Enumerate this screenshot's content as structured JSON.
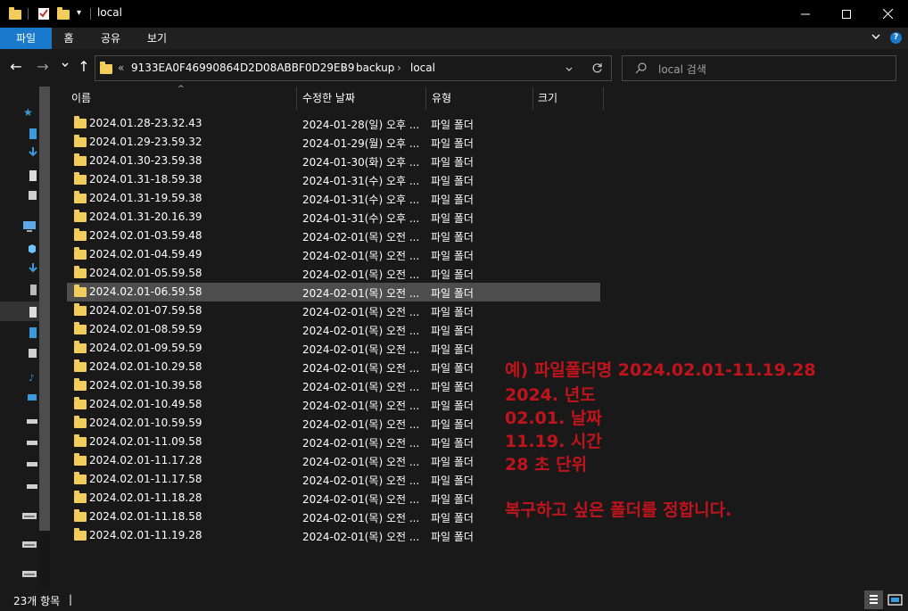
{
  "window": {
    "title": "local",
    "minimize": "—",
    "maximize": "☐",
    "close": "✕"
  },
  "ribbon": {
    "tabs": [
      "파일",
      "홈",
      "공유",
      "보기"
    ]
  },
  "nav": {
    "back": "←",
    "forward": "→",
    "recent": "⌄",
    "up": "↑",
    "breadcrumb_overflow": "«",
    "path": [
      "9133EA0F46990864D2D08ABBF0D29EB9",
      "backup",
      "local"
    ],
    "separator": "›",
    "search_placeholder": "local 검색"
  },
  "columns": {
    "name": "이름",
    "date": "수정한 날짜",
    "type": "유형",
    "size": "크기"
  },
  "files": [
    {
      "name": "2024.01.28-23.32.43",
      "date": "2024-01-28(일) 오후 ...",
      "type": "파일 폴더"
    },
    {
      "name": "2024.01.29-23.59.32",
      "date": "2024-01-29(월) 오후 ...",
      "type": "파일 폴더"
    },
    {
      "name": "2024.01.30-23.59.38",
      "date": "2024-01-30(화) 오후 ...",
      "type": "파일 폴더"
    },
    {
      "name": "2024.01.31-18.59.38",
      "date": "2024-01-31(수) 오후 ...",
      "type": "파일 폴더"
    },
    {
      "name": "2024.01.31-19.59.38",
      "date": "2024-01-31(수) 오후 ...",
      "type": "파일 폴더"
    },
    {
      "name": "2024.01.31-20.16.39",
      "date": "2024-01-31(수) 오후 ...",
      "type": "파일 폴더"
    },
    {
      "name": "2024.02.01-03.59.48",
      "date": "2024-02-01(목) 오전 ...",
      "type": "파일 폴더"
    },
    {
      "name": "2024.02.01-04.59.49",
      "date": "2024-02-01(목) 오전 ...",
      "type": "파일 폴더"
    },
    {
      "name": "2024.02.01-05.59.58",
      "date": "2024-02-01(목) 오전 ...",
      "type": "파일 폴더"
    },
    {
      "name": "2024.02.01-06.59.58",
      "date": "2024-02-01(목) 오전 ...",
      "type": "파일 폴더",
      "selected": true
    },
    {
      "name": "2024.02.01-07.59.58",
      "date": "2024-02-01(목) 오전 ...",
      "type": "파일 폴더"
    },
    {
      "name": "2024.02.01-08.59.59",
      "date": "2024-02-01(목) 오전 ...",
      "type": "파일 폴더"
    },
    {
      "name": "2024.02.01-09.59.59",
      "date": "2024-02-01(목) 오전 ...",
      "type": "파일 폴더"
    },
    {
      "name": "2024.02.01-10.29.58",
      "date": "2024-02-01(목) 오전 ...",
      "type": "파일 폴더"
    },
    {
      "name": "2024.02.01-10.39.58",
      "date": "2024-02-01(목) 오전 ...",
      "type": "파일 폴더"
    },
    {
      "name": "2024.02.01-10.49.58",
      "date": "2024-02-01(목) 오전 ...",
      "type": "파일 폴더"
    },
    {
      "name": "2024.02.01-10.59.59",
      "date": "2024-02-01(목) 오전 ...",
      "type": "파일 폴더"
    },
    {
      "name": "2024.02.01-11.09.58",
      "date": "2024-02-01(목) 오전 ...",
      "type": "파일 폴더"
    },
    {
      "name": "2024.02.01-11.17.28",
      "date": "2024-02-01(목) 오전 ...",
      "type": "파일 폴더"
    },
    {
      "name": "2024.02.01-11.17.58",
      "date": "2024-02-01(목) 오전 ...",
      "type": "파일 폴더"
    },
    {
      "name": "2024.02.01-11.18.28",
      "date": "2024-02-01(목) 오전 ...",
      "type": "파일 폴더"
    },
    {
      "name": "2024.02.01-11.18.58",
      "date": "2024-02-01(목) 오전 ...",
      "type": "파일 폴더"
    },
    {
      "name": "2024.02.01-11.19.28",
      "date": "2024-02-01(목) 오전 ...",
      "type": "파일 폴더"
    }
  ],
  "annotation": {
    "lines": [
      "예) 파일폴더명 2024.02.01-11.19.28",
      " 2024. 년도",
      "02.01. 날짜",
      "11.19. 시간",
      "28 초 단위",
      "복구하고 싶은 폴더를 정합니다."
    ],
    "color": "#c0141c"
  },
  "status": {
    "item_count": "23개 항목",
    "cursor": "|"
  },
  "colors": {
    "accent": "#1979ca",
    "folder": "#f3cd5b",
    "selected_row": "#4d4d4d"
  },
  "icons": {
    "folder": "folder-icon",
    "search": "search-icon",
    "refresh": "refresh-icon",
    "help": "help-icon",
    "chevron": "chevron-down-icon"
  }
}
